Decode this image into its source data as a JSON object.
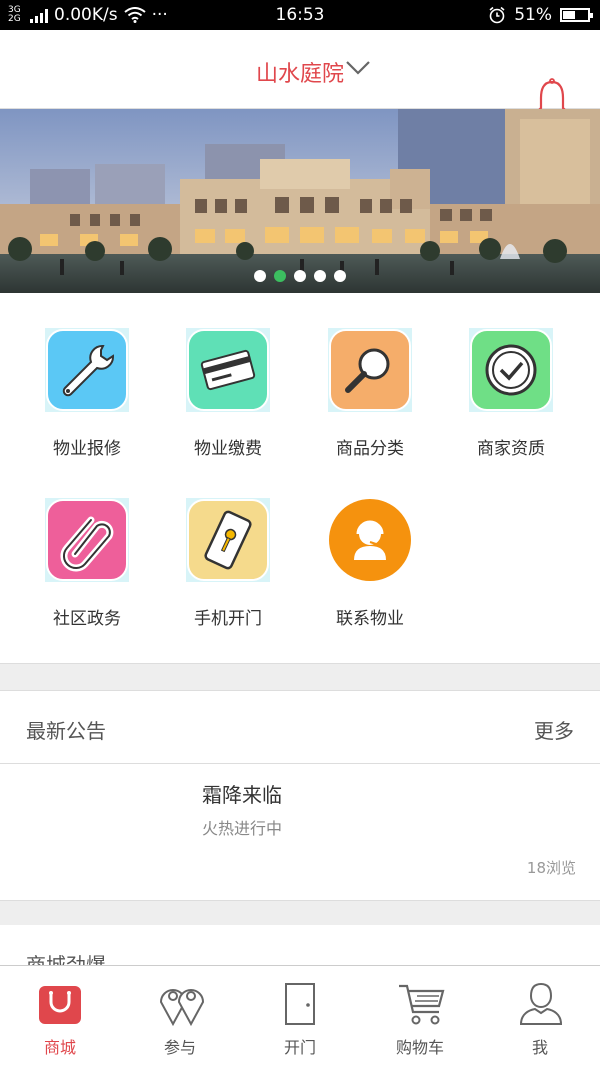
{
  "status_bar": {
    "network_type": "3G 2G",
    "speed": "0.00K/s",
    "more": "···",
    "time": "16:53",
    "battery": "51%",
    "battery_level": 0.51
  },
  "header": {
    "title": "山水庭院",
    "accent_color": "#e0474c"
  },
  "banner": {
    "slide_count": 5,
    "active_slide": 2
  },
  "services": [
    {
      "label": "物业报修",
      "icon": "wrench-icon",
      "color": "#5bc8f5"
    },
    {
      "label": "物业缴费",
      "icon": "card-icon",
      "color": "#5fe0b6"
    },
    {
      "label": "商品分类",
      "icon": "magnifier-icon",
      "color": "#f5ad6a"
    },
    {
      "label": "商家资质",
      "icon": "check-circle-icon",
      "color": "#6fdf86"
    },
    {
      "label": "社区政务",
      "icon": "paperclip-icon",
      "color": "#ee5f9a"
    },
    {
      "label": "手机开门",
      "icon": "phone-key-icon",
      "color": "#f5da8c"
    },
    {
      "label": "联系物业",
      "icon": "service-agent-icon",
      "color": "#f5920e"
    }
  ],
  "notices": {
    "title": "最新公告",
    "more": "更多",
    "items": [
      {
        "title": "霜降来临",
        "subtitle": "火热进行中",
        "views": "18浏览"
      }
    ]
  },
  "mall_section": {
    "title": "商城劲爆"
  },
  "tabbar": {
    "active_color": "#e0474c",
    "items": [
      {
        "label": "商城",
        "icon": "shopping-bag-icon"
      },
      {
        "label": "参与",
        "icon": "location-pins-icon"
      },
      {
        "label": "开门",
        "icon": "door-icon"
      },
      {
        "label": "购物车",
        "icon": "cart-icon"
      },
      {
        "label": "我",
        "icon": "user-icon"
      }
    ]
  }
}
